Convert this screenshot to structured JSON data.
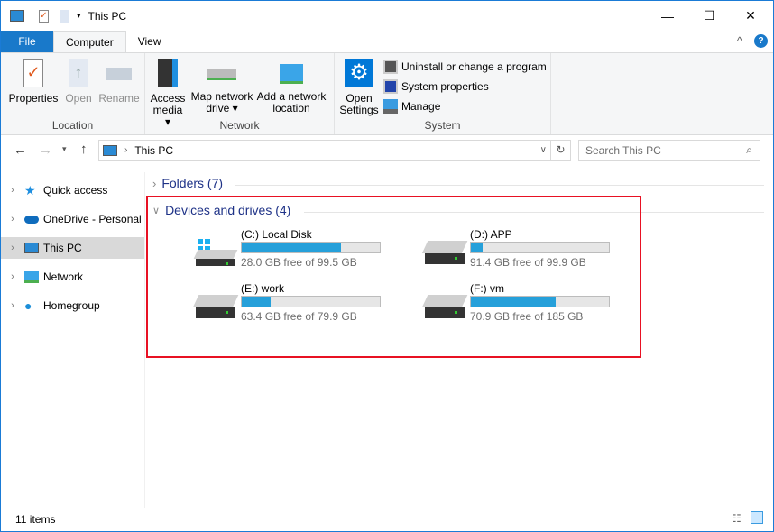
{
  "window": {
    "title": "This PC",
    "minimize": "—",
    "maximize": "☐",
    "close": "✕"
  },
  "tabs": [
    {
      "label": "File"
    },
    {
      "label": "Computer"
    },
    {
      "label": "View"
    }
  ],
  "ribbon": {
    "location": {
      "label": "Location",
      "properties": "Properties",
      "open": "Open",
      "rename": "Rename"
    },
    "network": {
      "label": "Network",
      "access_media": "Access media",
      "map_drive": "Map network drive",
      "add_location": "Add a network location"
    },
    "system": {
      "label": "System",
      "open_settings": "Open Settings",
      "uninstall": "Uninstall or change a program",
      "system_properties": "System properties",
      "manage": "Manage"
    }
  },
  "address": {
    "path": "This PC",
    "search_placeholder": "Search This PC"
  },
  "nav": [
    {
      "label": "Quick access"
    },
    {
      "label": "OneDrive - Personal"
    },
    {
      "label": "This PC",
      "selected": true
    },
    {
      "label": "Network"
    },
    {
      "label": "Homegroup"
    }
  ],
  "folders": {
    "label": "Folders (7)"
  },
  "devices": {
    "label": "Devices and drives (4)",
    "drives": [
      {
        "name": "(C:) Local Disk",
        "free": "28.0 GB free of 99.5 GB",
        "used_percent": 71.9,
        "system": true
      },
      {
        "name": "(D:) APP",
        "free": "91.4 GB free of 99.9 GB",
        "used_percent": 8.5
      },
      {
        "name": "(E:) work",
        "free": "63.4 GB free of 79.9 GB",
        "used_percent": 20.7
      },
      {
        "name": "(F:) vm",
        "free": "70.9 GB free of 185 GB",
        "used_percent": 61.7
      }
    ]
  },
  "status": {
    "items": "11 items"
  },
  "colors": {
    "accent": "#1979ca",
    "bar_fill": "#26a0da",
    "highlight": "#e81123"
  }
}
